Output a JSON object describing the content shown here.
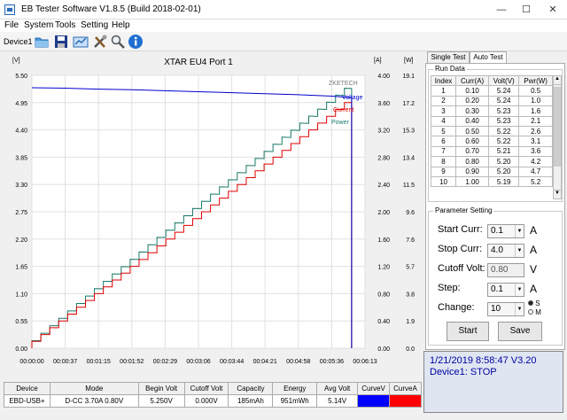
{
  "window": {
    "title": "EB Tester Software V1.8.5 (Build 2018-02-01)"
  },
  "menu": [
    "File",
    "System",
    "Tools",
    "Setting",
    "Help"
  ],
  "toolbar": {
    "device_label": "Device1"
  },
  "chart_data": {
    "type": "line",
    "title": "XTAR EU4 Port 1",
    "x_ticks": [
      "00:00:00",
      "00:00:37",
      "00:01:15",
      "00:01:52",
      "00:02:29",
      "00:03:06",
      "00:03:44",
      "00:04:21",
      "00:04:58",
      "00:05:36",
      "00:06:13"
    ],
    "left_axis": {
      "unit": "[V]",
      "range": [
        0,
        5.5
      ],
      "ticks": [
        "0.00",
        "0.55",
        "1.10",
        "1.65",
        "2.20",
        "2.75",
        "3.30",
        "3.85",
        "4.40",
        "4.95",
        "5.50"
      ]
    },
    "current_axis": {
      "unit": "[A]",
      "range": [
        0,
        4.0
      ],
      "ticks": [
        "0.00",
        "0.40",
        "0.80",
        "1.20",
        "1.60",
        "2.00",
        "2.40",
        "2.80",
        "3.20",
        "3.60",
        "4.00"
      ]
    },
    "power_axis": {
      "unit": "[W]",
      "range": [
        0,
        19.1
      ],
      "ticks": [
        "0.0",
        "1.9",
        "3.8",
        "5.7",
        "7.6",
        "9.6",
        "11.5",
        "13.4",
        "15.3",
        "17.2",
        "19.1"
      ]
    },
    "watermark": "ZKETECH",
    "series": [
      {
        "name": "Voltage",
        "color": "#0000cc",
        "points": [
          [
            0,
            5.25
          ],
          [
            37,
            5.24
          ],
          [
            75,
            5.22
          ],
          [
            112,
            5.21
          ],
          [
            149,
            5.19
          ],
          [
            186,
            5.17
          ],
          [
            224,
            5.15
          ],
          [
            261,
            5.13
          ],
          [
            298,
            5.11
          ],
          [
            336,
            5.08
          ],
          [
            358,
            5.05
          ]
        ]
      },
      {
        "name": "Current",
        "color": "#e00000",
        "step": 10,
        "step_value": 0.1,
        "max": 3.7
      },
      {
        "name": "Power",
        "color": "#1a7a6a"
      }
    ],
    "end_time_s": 358
  },
  "tabs": [
    {
      "label": "Single Test"
    },
    {
      "label": "Auto Test"
    }
  ],
  "run_data": {
    "label": "Run Data",
    "headers": [
      "Index",
      "Curr(A)",
      "Volt(V)",
      "Pwr(W)"
    ],
    "rows": [
      [
        "1",
        "0.10",
        "5.24",
        "0.5"
      ],
      [
        "2",
        "0.20",
        "5.24",
        "1.0"
      ],
      [
        "3",
        "0.30",
        "5.23",
        "1.6"
      ],
      [
        "4",
        "0.40",
        "5.23",
        "2.1"
      ],
      [
        "5",
        "0.50",
        "5.22",
        "2.6"
      ],
      [
        "6",
        "0.60",
        "5.22",
        "3.1"
      ],
      [
        "7",
        "0.70",
        "5.21",
        "3.6"
      ],
      [
        "8",
        "0.80",
        "5.20",
        "4.2"
      ],
      [
        "9",
        "0.90",
        "5.20",
        "4.7"
      ],
      [
        "10",
        "1.00",
        "5.19",
        "5.2"
      ]
    ]
  },
  "params": {
    "label": "Parameter Setting",
    "start_curr": {
      "label": "Start Curr:",
      "value": "0.1",
      "unit": "A"
    },
    "stop_curr": {
      "label": "Stop Curr:",
      "value": "4.0",
      "unit": "A"
    },
    "cutoff_volt": {
      "label": "Cutoff Volt:",
      "value": "0.80",
      "unit": "V"
    },
    "step": {
      "label": "Step:",
      "value": "0.1",
      "unit": "A"
    },
    "change": {
      "label": "Change:",
      "value": "10",
      "opt_s": "S",
      "opt_m": "M"
    }
  },
  "buttons": {
    "start": "Start",
    "save": "Save"
  },
  "status": {
    "line1": "1/21/2019 8:58:47  V3.20",
    "line2": "Device1: STOP"
  },
  "summary": {
    "headers": [
      "Device",
      "Mode",
      "Begin Volt",
      "Cutoff Volt",
      "Capacity",
      "Energy",
      "Avg Volt",
      "CurveV",
      "CurveA"
    ],
    "values": [
      "EBD-USB+",
      "D-CC  3.70A  0.80V",
      "5.250V",
      "0.000V",
      "185mAh",
      "951mWh",
      "5.14V",
      "",
      ""
    ],
    "curve_v_color": "#0000ff",
    "curve_a_color": "#ff0000"
  }
}
